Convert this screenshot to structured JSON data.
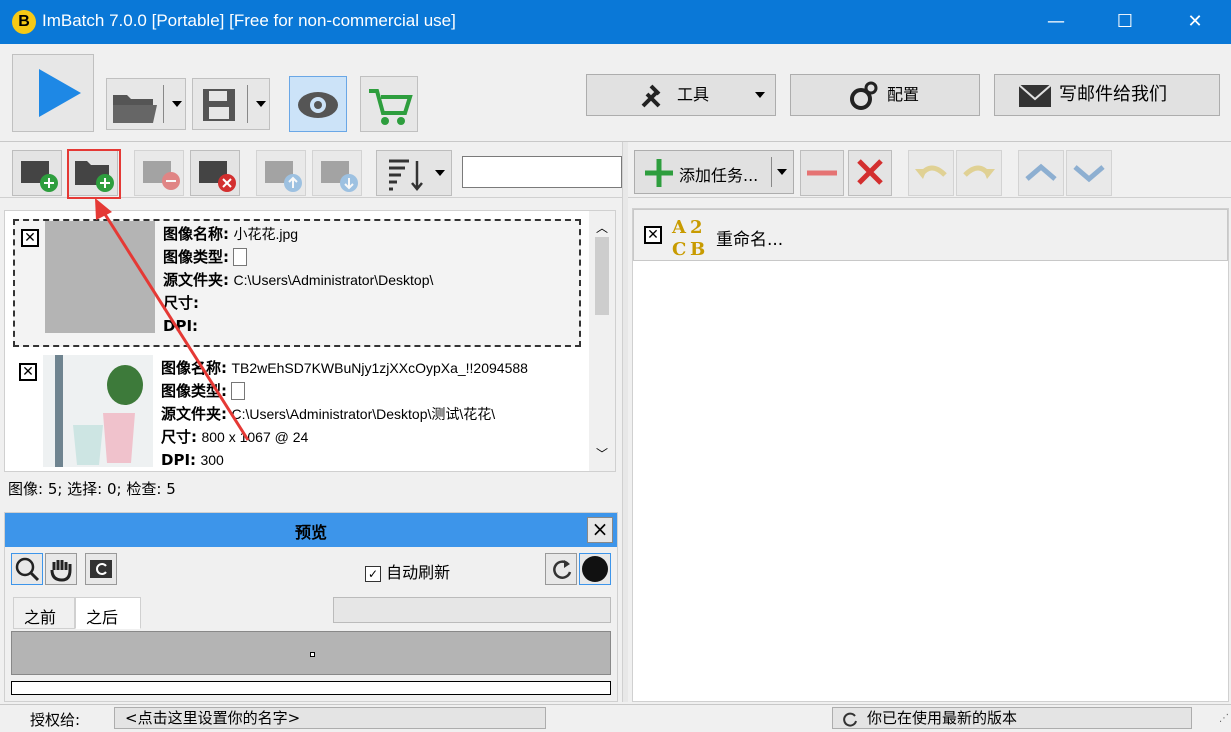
{
  "window": {
    "title": "ImBatch 7.0.0 [Portable] [Free for non-commercial use]",
    "logo": "B",
    "minimize": "—",
    "maximize": "☐",
    "close": "✕"
  },
  "top_toolbar": {
    "tools_label": "工具",
    "config_label": "配置",
    "mail_label": "写邮件给我们"
  },
  "images_toolbar": {
    "search_placeholder": ""
  },
  "image_list": {
    "items": [
      {
        "name_label": "图像名称:",
        "name_value": "小花花.jpg",
        "type_label": "图像类型:",
        "folder_label": "源文件夹:",
        "folder_value": "C:\\Users\\Administrator\\Desktop\\",
        "size_label": "尺寸:",
        "size_value": "",
        "dpi_label": "DPI:",
        "dpi_value": ""
      },
      {
        "name_label": "图像名称:",
        "name_value": "TB2wEhSD7KWBuNjy1zjXXcOypXa_!!2094588",
        "type_label": "图像类型:",
        "folder_label": "源文件夹:",
        "folder_value": "C:\\Users\\Administrator\\Desktop\\测试\\花花\\",
        "size_label": "尺寸:",
        "size_value": "800 x 1067 @ 24",
        "dpi_label": "DPI:",
        "dpi_value": "300"
      }
    ],
    "status": "图像: 5; 选择: 0; 检查: 5"
  },
  "preview": {
    "title": "预览",
    "auto_refresh_label": "自动刷新",
    "tab_before": "之前",
    "tab_after": "之后"
  },
  "tasks": {
    "add_task_label": "添加任务...",
    "items": [
      {
        "label": "重命名..."
      }
    ]
  },
  "bottom": {
    "license_label": "授权给:",
    "name_placeholder": "<点击这里设置你的名字>",
    "version_status": "你已在使用最新的版本"
  },
  "colors": {
    "titlebar": "#0a78d7",
    "preview_header": "#3d95ea",
    "accent_green": "#2e9e3e",
    "accent_red": "#d32f2f",
    "annotation": "#e53935"
  }
}
